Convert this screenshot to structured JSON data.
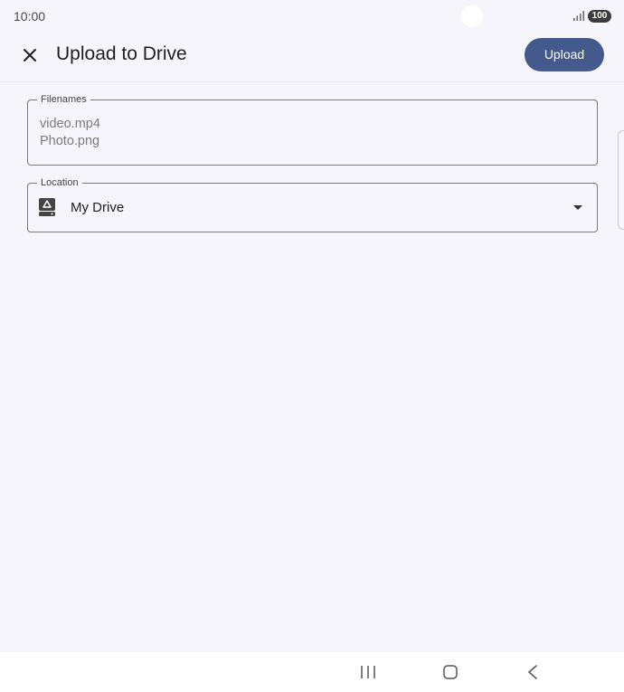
{
  "status_bar": {
    "time": "10:00",
    "battery": "100",
    "icons": [
      "signal-icon",
      "battery-icon"
    ]
  },
  "app_bar": {
    "close_icon": "close-icon",
    "title": "Upload to Drive",
    "upload_label": "Upload",
    "accent_color": "#455a8c"
  },
  "form": {
    "filenames": {
      "label": "Filenames",
      "value": "video.mp4\nPhoto.png"
    },
    "location": {
      "label": "Location",
      "icon": "drive-icon",
      "value": "My Drive",
      "dropdown_icon": "dropdown-arrow-icon"
    }
  },
  "nav_bar": {
    "buttons": [
      "recents-icon",
      "home-icon",
      "back-icon"
    ]
  }
}
